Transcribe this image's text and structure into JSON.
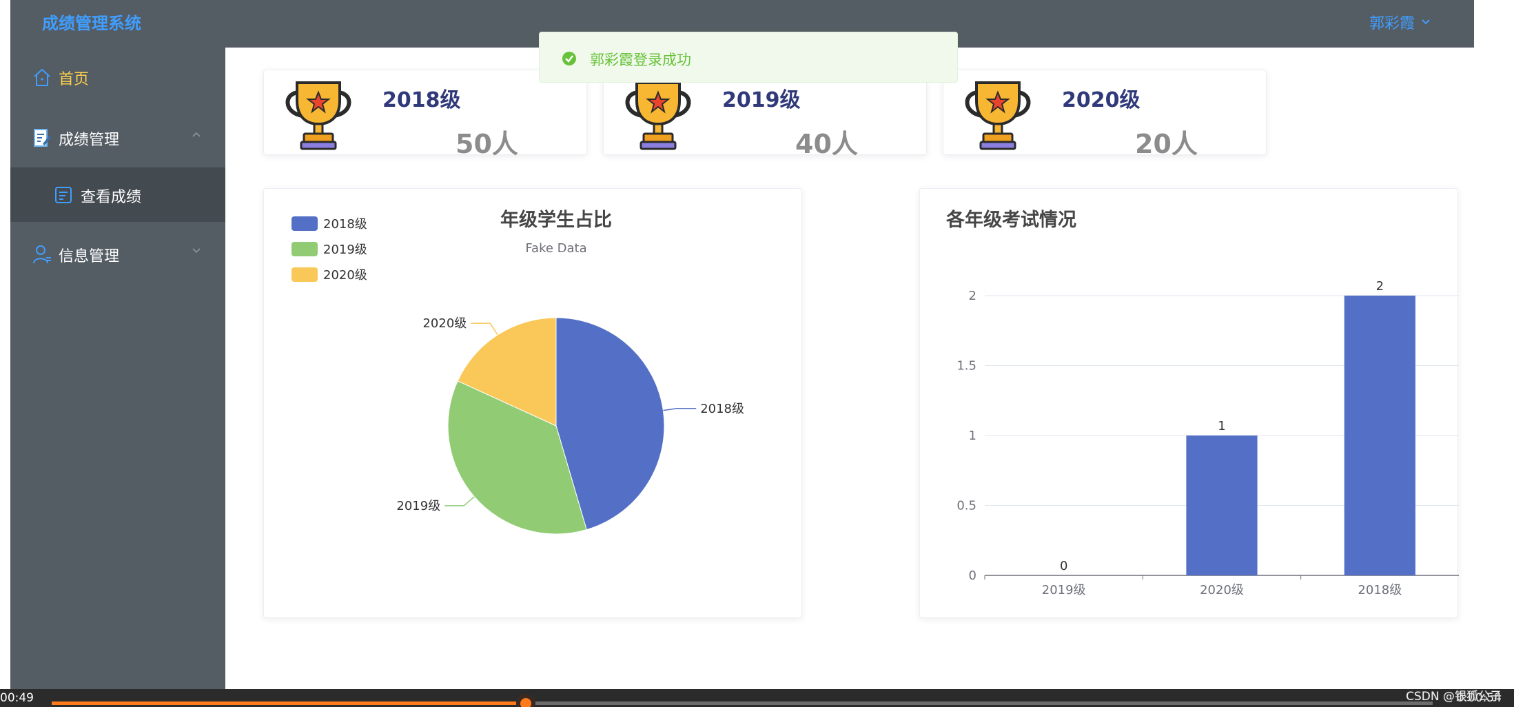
{
  "app": {
    "brand": "成绩管理系统",
    "user_name": "郭彩霞"
  },
  "colors": {
    "header_bg": "#545c64",
    "accent": "#409eff",
    "active": "#ffd04b",
    "success": "#67c23a",
    "series": [
      "#5470c6",
      "#91cc75",
      "#fac858"
    ]
  },
  "sidebar": {
    "items": [
      {
        "label": "首页",
        "icon": "home-icon",
        "active": true
      },
      {
        "label": "成绩管理",
        "icon": "edit-doc-icon",
        "expanded": true
      },
      {
        "label": "查看成绩",
        "icon": "notes-icon",
        "sub": true
      },
      {
        "label": "信息管理",
        "icon": "user-icon",
        "expanded": false
      }
    ]
  },
  "toast": {
    "message": "郭彩霞登录成功"
  },
  "stats": [
    {
      "grade": "2018级",
      "count": "50人",
      "icon": "trophy-icon"
    },
    {
      "grade": "2019级",
      "count": "40人",
      "icon": "trophy-icon"
    },
    {
      "grade": "2020级",
      "count": "20人",
      "icon": "trophy-icon"
    }
  ],
  "chart_data": [
    {
      "type": "pie",
      "title": "年级学生占比",
      "subtitle": "Fake Data",
      "legend": {
        "position": "top-left",
        "entries": [
          "2018级",
          "2019级",
          "2020级"
        ]
      },
      "categories": [
        "2018级",
        "2019级",
        "2020级"
      ],
      "values": [
        50,
        40,
        20
      ]
    },
    {
      "type": "bar",
      "title": "各年级考试情况",
      "categories": [
        "2019级",
        "2020级",
        "2018级"
      ],
      "values": [
        0,
        1,
        2
      ],
      "ylim": [
        0,
        2
      ],
      "yticks": [
        "0",
        "0.5",
        "1",
        "1.5",
        "2"
      ],
      "ytick_values": [
        0,
        0.5,
        1,
        1.5,
        2
      ],
      "data_labels": [
        "0",
        "1",
        "2"
      ],
      "grid": true
    }
  ],
  "player": {
    "current_time": "00:49",
    "total_time": "0:00:54",
    "progress": 0.3435
  },
  "watermark": "CSDN @银狐公子"
}
